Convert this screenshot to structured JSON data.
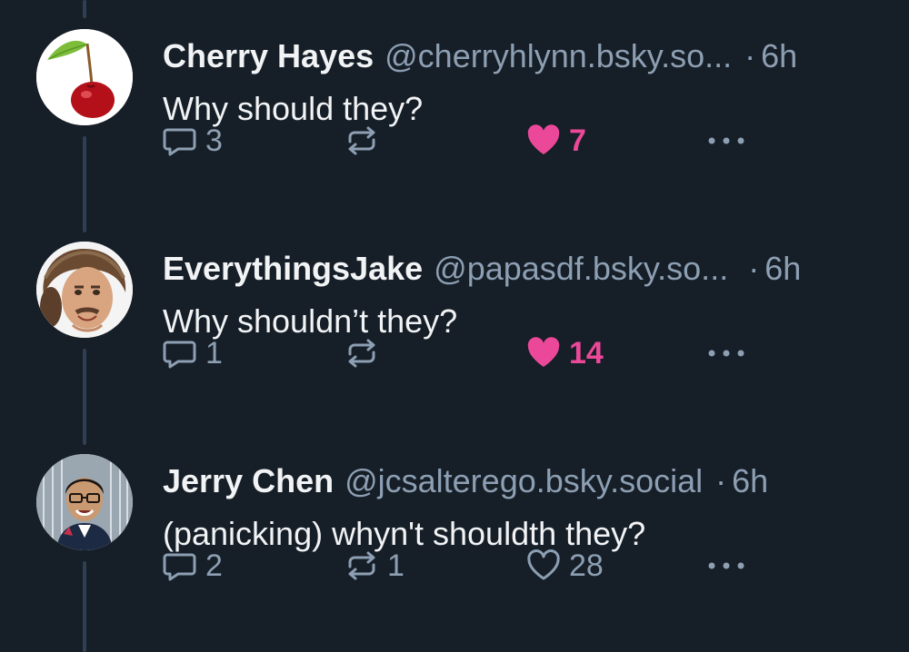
{
  "colors": {
    "background": "#161e27",
    "text_primary": "#f1f3f5",
    "text_secondary": "#8d9fb3",
    "like_accent": "#ec4899",
    "thread_line": "#2e4052"
  },
  "posts": [
    {
      "display_name": "Cherry Hayes",
      "handle": "@cherryhlynn.bsky.so...",
      "separator": "·",
      "time": "6h",
      "text": "Why should they?",
      "avatar_icon": "cherry-avatar",
      "reply_count": "3",
      "repost_count": "",
      "like_count": "7",
      "liked": true,
      "more_icon": "ellipsis-icon"
    },
    {
      "display_name": "EverythingsJake",
      "handle": "@papasdf.bsky.so...",
      "separator": "·",
      "time": "6h",
      "text": "Why shouldn’t they?",
      "avatar_icon": "person-avatar",
      "reply_count": "1",
      "repost_count": "",
      "like_count": "14",
      "liked": true,
      "more_icon": "ellipsis-icon"
    },
    {
      "display_name": "Jerry Chen",
      "handle": "@jcsalterego.bsky.social",
      "separator": "·",
      "time": "6h",
      "text": "(panicking) whyn't shouldth they?",
      "avatar_icon": "person-avatar",
      "reply_count": "2",
      "repost_count": "1",
      "like_count": "28",
      "liked": false,
      "more_icon": "ellipsis-icon"
    }
  ]
}
